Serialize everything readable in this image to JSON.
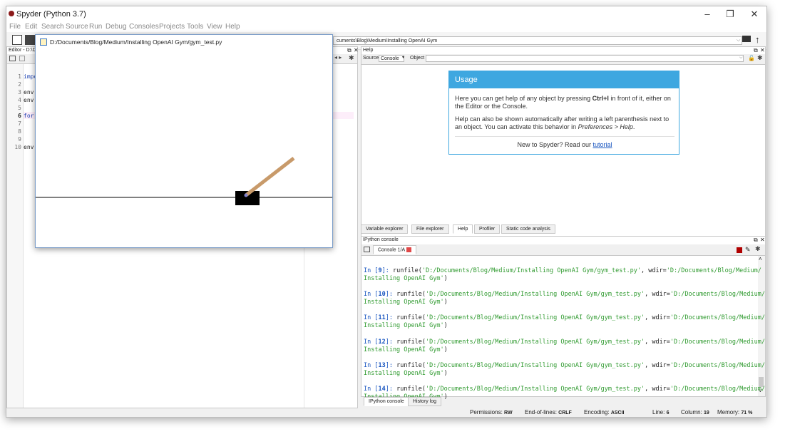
{
  "window": {
    "title": "Spyder (Python 3.7)",
    "minimize": "–",
    "maximize": "❐",
    "close": "✕"
  },
  "menu": [
    "File",
    "Edit",
    "Search",
    "Source",
    "Run",
    "Debug",
    "Consoles",
    "Projects",
    "Tools",
    "View",
    "Help"
  ],
  "toolbar": {
    "path": "cuments\\Blog\\Medium\\Installing OpenAI Gym"
  },
  "editor": {
    "title": "Editor - D:\\D",
    "lines": [
      {
        "n": "1",
        "code": "impo"
      },
      {
        "n": "2",
        "code": ""
      },
      {
        "n": "3",
        "code": "env"
      },
      {
        "n": "4",
        "code": "env."
      },
      {
        "n": "5",
        "code": ""
      },
      {
        "n": "6",
        "code": "for"
      },
      {
        "n": "7",
        "code": ""
      },
      {
        "n": "8",
        "code": ""
      },
      {
        "n": "9",
        "code": ""
      },
      {
        "n": "10",
        "code": "env."
      }
    ]
  },
  "gym_window": {
    "title": "D:/Documents/Blog/Medium/Installing OpenAI Gym/gym_test.py"
  },
  "help": {
    "title": "Help",
    "source_label": "Source",
    "source_value": "Console",
    "object_label": "Object",
    "usage_title": "Usage",
    "p1_a": "Here you can get help of any object by pressing ",
    "p1_b": "Ctrl+I",
    "p1_c": " in front of it, either on the Editor or the Console.",
    "p2_a": "Help can also be shown automatically after writing a left parenthesis next to an object. You can activate this behavior in ",
    "p2_b": "Preferences > Help",
    "p2_c": ".",
    "p3_a": "New to Spyder? Read our ",
    "p3_link": "tutorial"
  },
  "help_tabs": [
    "Variable explorer",
    "File explorer",
    "Help",
    "Profiler",
    "Static code analysis"
  ],
  "console": {
    "title": "IPython console",
    "tab": "Console 1/A",
    "entries": [
      {
        "n": "9"
      },
      {
        "n": "10"
      },
      {
        "n": "11"
      },
      {
        "n": "12"
      },
      {
        "n": "13"
      },
      {
        "n": "14"
      }
    ],
    "cmd_pre": "runfile(",
    "file_str": "'D:/Documents/Blog/Medium/Installing OpenAI Gym/gym_test.py'",
    "mid": ", wdir=",
    "wdir_a": "'D:/Documents/Blog/Medium/",
    "wdir_b": "Installing OpenAI Gym'",
    "close": ")"
  },
  "console_tabs": [
    "IPython console",
    "History log"
  ],
  "status": {
    "perm_label": "Permissions:",
    "perm": "RW",
    "eol_label": "End-of-lines:",
    "eol": "CRLF",
    "enc_label": "Encoding:",
    "enc": "ASCII",
    "line_label": "Line:",
    "line": "6",
    "col_label": "Column:",
    "col": "19",
    "mem_label": "Memory:",
    "mem": "71 %"
  }
}
